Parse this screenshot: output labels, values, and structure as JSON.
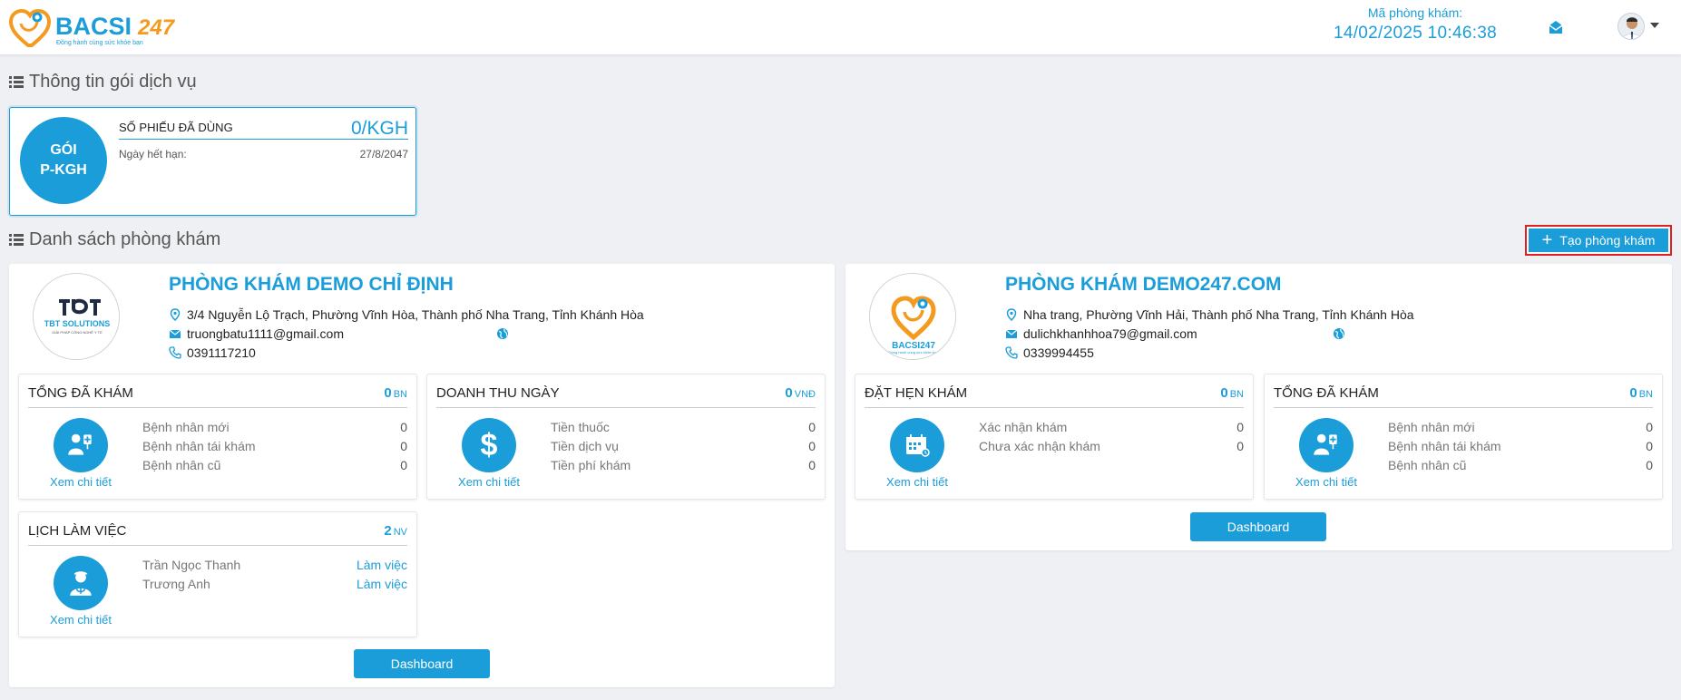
{
  "header": {
    "logo_text": "BACSI247",
    "logo_tagline": "Đồng hành cùng sức khỏe bạn",
    "clinic_code_label": "Mã phòng khám:",
    "datetime": "14/02/2025 10:46:38",
    "icons": {
      "mail": "mail-icon",
      "caret": "chevron-down-icon"
    }
  },
  "service_section": {
    "title": "Thông tin gói dịch vụ",
    "package": {
      "name_line1": "GÓI",
      "name_line2": "P-KGH",
      "used_label": "SỐ PHIẾU ĐÃ DÙNG",
      "used_value": "0/KGH",
      "expiry_label": "Ngày hết hạn:",
      "expiry_value": "27/8/2047"
    }
  },
  "clinic_section": {
    "title": "Danh sách phòng khám",
    "create_button": "Tạo phòng khám"
  },
  "clinics": [
    {
      "logo_text": "TBT SOLUTIONS",
      "logo_tagline": "GIẢI PHÁP CÔNG NGHỆ Y TẾ",
      "name": "PHÒNG KHÁM DEMO CHỈ ĐỊNH",
      "address": "3/4 Nguyễn Lộ Trạch, Phường Vĩnh Hòa, Thành phố Nha Trang, Tỉnh Khánh Hòa",
      "email": "truongbatu1111@gmail.com",
      "phone": "0391117210",
      "stats": [
        {
          "title": "TỔNG ĐÃ KHÁM",
          "count": "0",
          "unit": "BN",
          "icon": "patient-icon",
          "link": "Xem chi tiết",
          "rows": [
            {
              "label": "Bệnh nhân mới",
              "value": "0"
            },
            {
              "label": "Bệnh nhân tái khám",
              "value": "0"
            },
            {
              "label": "Bệnh nhân cũ",
              "value": "0"
            }
          ]
        },
        {
          "title": "DOANH THU NGÀY",
          "count": "0",
          "unit": "VNĐ",
          "icon": "dollar-icon",
          "link": "Xem chi tiết",
          "rows": [
            {
              "label": "Tiền thuốc",
              "value": "0"
            },
            {
              "label": "Tiền dịch vụ",
              "value": "0"
            },
            {
              "label": "Tiền phí khám",
              "value": "0"
            }
          ]
        },
        {
          "title": "LỊCH LÀM VIỆC",
          "count": "2",
          "unit": "NV",
          "icon": "doctor-icon",
          "link": "Xem chi tiết",
          "rows": [
            {
              "label": "Trần Ngọc Thanh",
              "value": "Làm việc"
            },
            {
              "label": "Trương Anh",
              "value": "Làm việc"
            }
          ]
        }
      ],
      "dashboard_button": "Dashboard"
    },
    {
      "logo_text": "BACSI247",
      "logo_tagline": "Đồng hành cùng sức khỏe bạn",
      "name": "PHÒNG KHÁM DEMO247.COM",
      "address": "Nha trang, Phường Vĩnh Hải, Thành phố Nha Trang, Tỉnh Khánh Hòa",
      "email": "dulichkhanhhoa79@gmail.com",
      "phone": "0339994455",
      "stats": [
        {
          "title": "ĐẶT HẸN KHÁM",
          "count": "0",
          "unit": "BN",
          "icon": "calendar-icon",
          "link": "Xem chi tiết",
          "rows": [
            {
              "label": "Xác nhận khám",
              "value": "0"
            },
            {
              "label": "Chưa xác nhận khám",
              "value": "0"
            }
          ]
        },
        {
          "title": "TỔNG ĐÃ KHÁM",
          "count": "0",
          "unit": "BN",
          "icon": "patient-icon",
          "link": "Xem chi tiết",
          "rows": [
            {
              "label": "Bệnh nhân mới",
              "value": "0"
            },
            {
              "label": "Bệnh nhân tái khám",
              "value": "0"
            },
            {
              "label": "Bệnh nhân cũ",
              "value": "0"
            }
          ]
        }
      ],
      "dashboard_button": "Dashboard"
    }
  ],
  "colors": {
    "accent": "#1a9dd9",
    "brand_orange": "#f39a1f",
    "highlight_border": "#e02020",
    "background": "#eef0f3"
  }
}
